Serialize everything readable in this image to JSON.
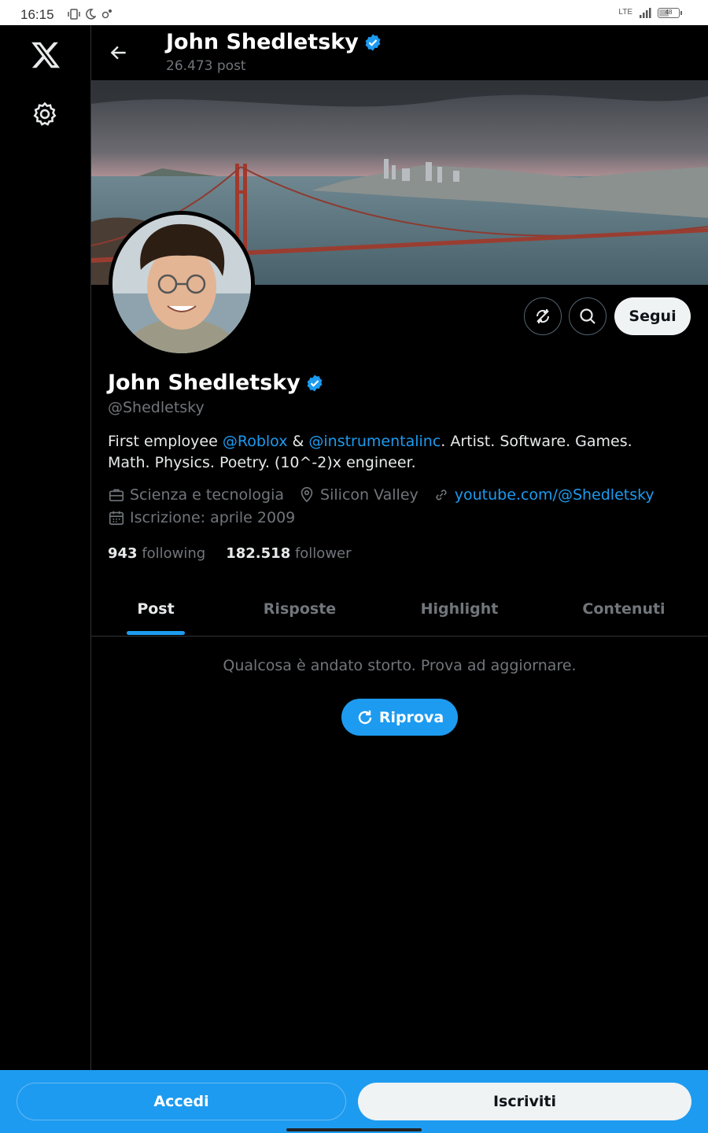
{
  "status_bar": {
    "time": "16:15",
    "network": "LTE",
    "battery": "48"
  },
  "header": {
    "name": "John Shedletsky",
    "post_count": "26.473 post"
  },
  "profile": {
    "name": "John Shedletsky",
    "handle": "@Shedletsky",
    "bio": {
      "p1": "First employee ",
      "m1": "@Roblox",
      "p2": " & ",
      "m2": "@instrumentalinc",
      "p3": ". Artist. Software. Games. Math. Physics. Poetry. (10^-2)x engineer."
    },
    "category": "Scienza e tecnologia",
    "location": "Silicon Valley",
    "website": "youtube.com/@Shedletsky",
    "joined": "Iscrizione: aprile 2009",
    "following_count": "943",
    "following_label": "following",
    "followers_count": "182.518",
    "followers_label": "follower"
  },
  "actions": {
    "follow_label": "Segui"
  },
  "tabs": [
    {
      "label": "Post"
    },
    {
      "label": "Risposte"
    },
    {
      "label": "Highlight"
    },
    {
      "label": "Contenuti"
    }
  ],
  "feed": {
    "error_text": "Qualcosa è andato storto. Prova ad aggiornare.",
    "retry_label": "Riprova"
  },
  "bottom": {
    "login_label": "Accedi",
    "signup_label": "Iscriviti"
  },
  "colors": {
    "accent": "#1d9bf0",
    "background": "#000000",
    "muted": "#71767b"
  }
}
